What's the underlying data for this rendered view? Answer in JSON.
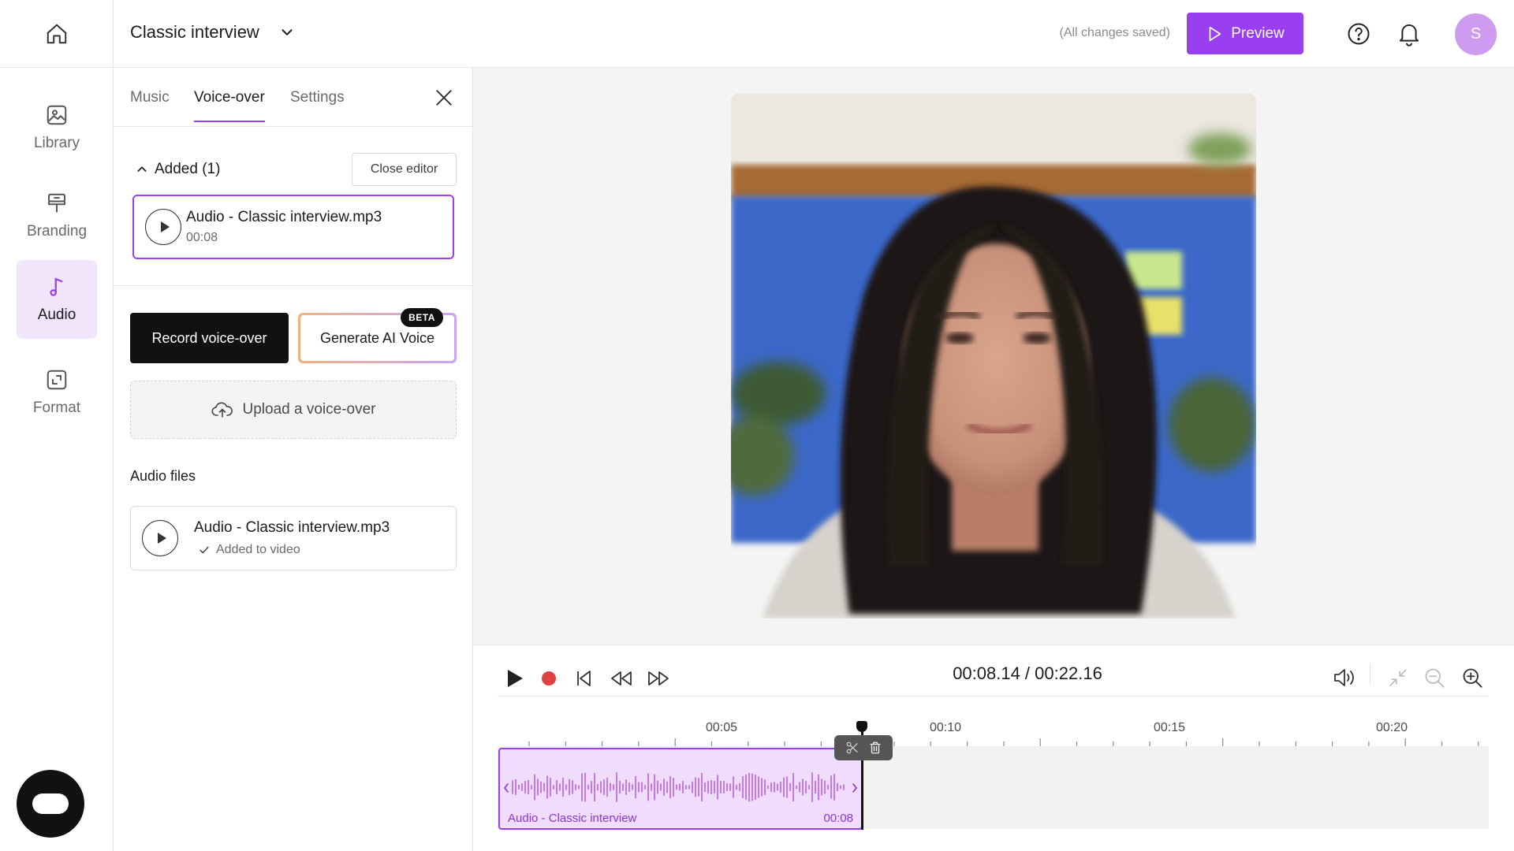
{
  "header": {
    "project_title": "Classic interview",
    "save_status": "(All changes saved)",
    "preview_label": "Preview",
    "avatar_initial": "S"
  },
  "colors": {
    "accent": "#9a3ff0",
    "accent_light": "#f1e5fc",
    "record_red": "#e04141"
  },
  "rail": {
    "items": [
      {
        "label": "Library",
        "icon": "library-icon"
      },
      {
        "label": "Branding",
        "icon": "branding-icon"
      },
      {
        "label": "Audio",
        "icon": "music-note-icon",
        "active": true
      },
      {
        "label": "Format",
        "icon": "format-icon"
      }
    ]
  },
  "panel": {
    "tabs": [
      {
        "label": "Music"
      },
      {
        "label": "Voice-over",
        "active": true
      },
      {
        "label": "Settings"
      }
    ],
    "added_heading": "Added (1)",
    "close_editor_label": "Close editor",
    "added_item": {
      "name": "Audio - Classic interview.mp3",
      "duration": "00:08"
    },
    "record_label": "Record voice-over",
    "ai_voice_label": "Generate AI Voice",
    "beta_badge": "BETA",
    "upload_label": "Upload a voice-over",
    "audio_files_heading": "Audio files",
    "audio_file": {
      "name": "Audio - Classic interview.mp3",
      "status": "Added to video"
    }
  },
  "player": {
    "time_display": "00:08.14 / 00:22.16",
    "ruler_labels": [
      "00:05",
      "00:10",
      "00:15",
      "00:20"
    ],
    "clip_label": "Audio - Classic interview",
    "clip_duration": "00:08"
  }
}
